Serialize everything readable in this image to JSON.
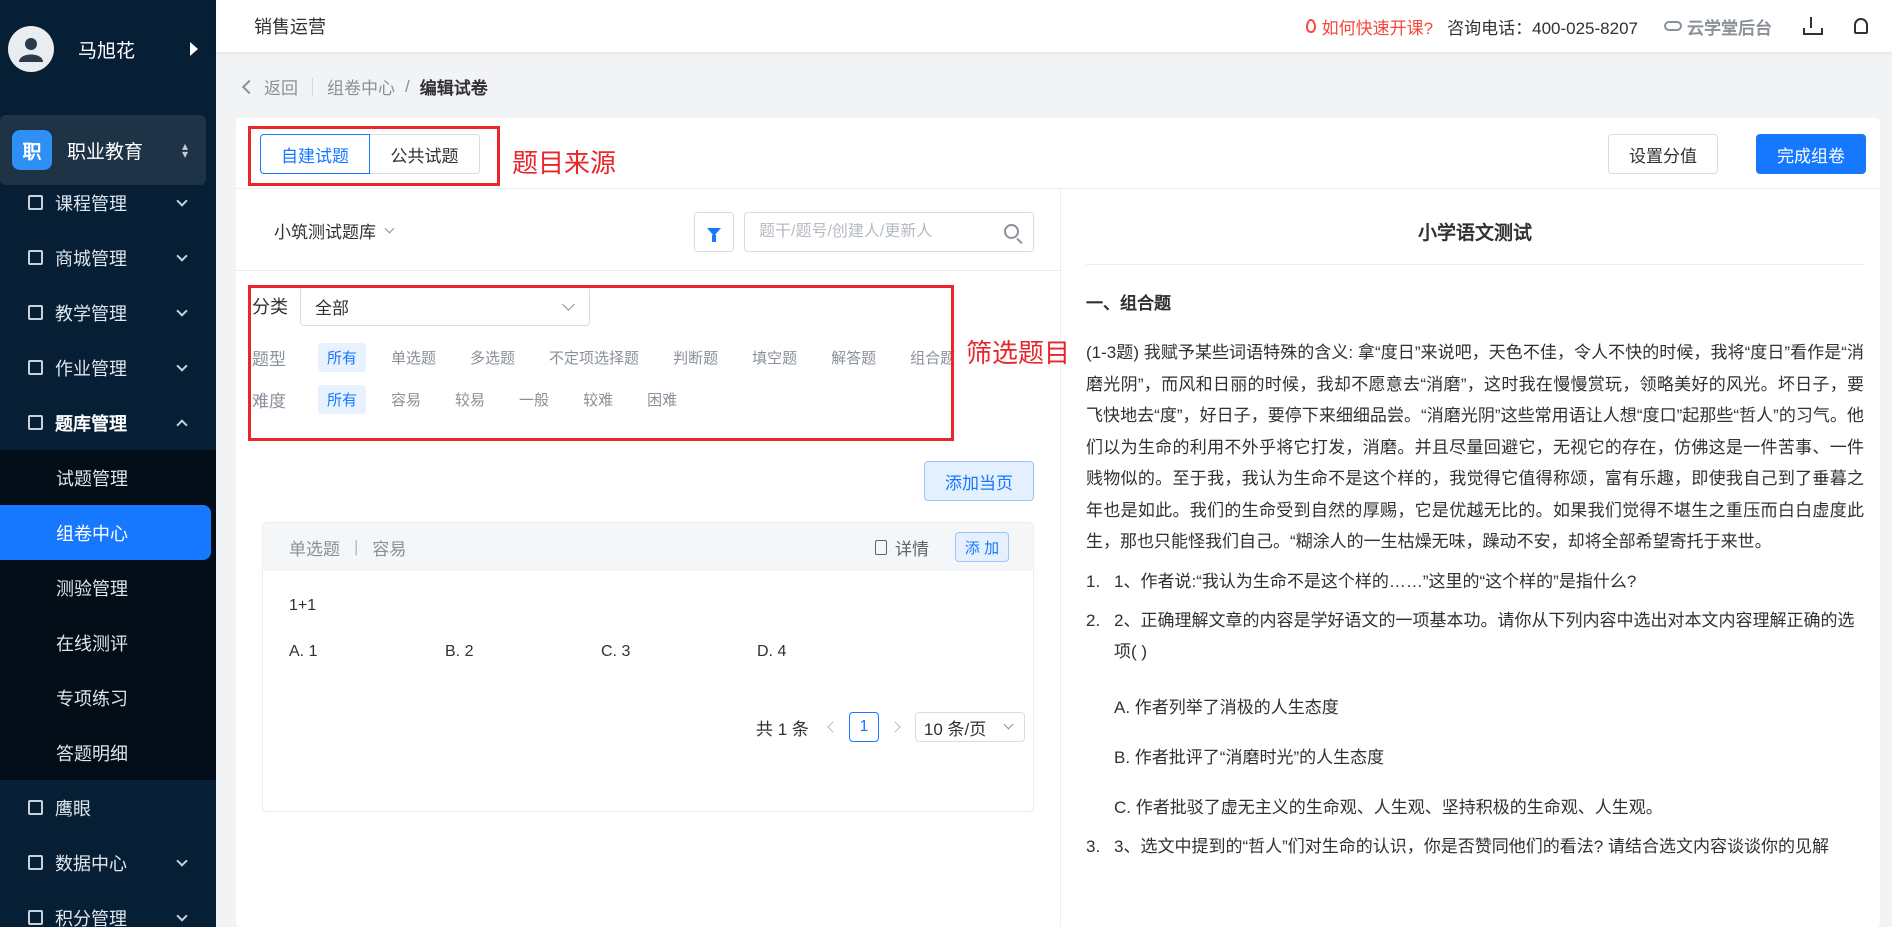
{
  "sidebar": {
    "user_name": "马旭花",
    "org_badge": "职",
    "org_name": "职业教育",
    "menu_top": [
      {
        "label": "课程管理"
      },
      {
        "label": "商城管理"
      },
      {
        "label": "教学管理"
      },
      {
        "label": "作业管理"
      },
      {
        "label": "题库管理"
      }
    ],
    "submenu": [
      {
        "label": "试题管理"
      },
      {
        "label": "组卷中心"
      },
      {
        "label": "测验管理"
      },
      {
        "label": "在线测评"
      },
      {
        "label": "专项练习"
      },
      {
        "label": "答题明细"
      }
    ],
    "menu_bottom": [
      {
        "label": "鹰眼"
      },
      {
        "label": "数据中心"
      },
      {
        "label": "积分管理"
      }
    ]
  },
  "topbar": {
    "title": "销售运营",
    "quick_start": "如何快速开课?",
    "phone": "咨询电话：400-025-8207",
    "backend": "云学堂后台"
  },
  "breadcrumb": {
    "back": "返回",
    "parent": "组卷中心",
    "sep": "/",
    "current": "编辑试卷"
  },
  "source_tabs": [
    "自建试题",
    "公共试题"
  ],
  "buttons": {
    "set_score": "设置分值",
    "finish": "完成组卷",
    "add_page": "添加当页"
  },
  "annotations": {
    "source": "题目来源",
    "filter": "筛选题目"
  },
  "bank_name": "小筑测试题库",
  "search": {
    "placeholder": "题干/题号/创建人/更新人"
  },
  "filters": {
    "category_label": "分类",
    "category_value": "全部",
    "type_label": "题型",
    "types": [
      "所有",
      "单选题",
      "多选题",
      "不定项选择题",
      "判断题",
      "填空题",
      "解答题",
      "组合题"
    ],
    "difficulty_label": "难度",
    "difficulties": [
      "所有",
      "容易",
      "较易",
      "一般",
      "较难",
      "困难"
    ]
  },
  "question": {
    "type": "单选题",
    "sep": "|",
    "difficulty": "容易",
    "detail": "详情",
    "add": "添 加",
    "stem": "1+1",
    "options": [
      "A.  1",
      "B.  2",
      "C.  3",
      "D.  4"
    ]
  },
  "pagination": {
    "total": "共 1 条",
    "current": "1",
    "page_size": "10 条/页"
  },
  "preview": {
    "title": "小学语文测试",
    "section": "一、组合题",
    "passage": "(1-3题)  我赋予某些词语特殊的含义: 拿“度日”来说吧，天色不佳，令人不快的时候，我将“度日”看作是“消磨光阴”，而风和日丽的时候，我却不愿意去“消磨”，这时我在慢慢赏玩，领略美好的风光。坏日子，要飞快地去“度”，好日子，要停下来细细品尝。“消磨光阴”这些常用语让人想“度口”起那些“哲人”的习气。他们以为生命的利用不外乎将它打发，消磨。并且尽量回避它，无视它的存在，仿佛这是一件苦事、一件贱物似的。至于我，我认为生命不是这个样的，我觉得它值得称颂，富有乐趣，即使我自己到了垂暮之年也是如此。我们的生命受到自然的厚赐，它是优越无比的。如果我们觉得不堪生之重压而白白虚度此生，那也只能怪我们自己。“糊涂人的一生枯燥无味，躁动不安，却将全部希望寄托于来世。",
    "questions": [
      {
        "num": "1.",
        "text": "1、作者说:“我认为生命不是这个样的……”这里的“这个样的”是指什么?"
      },
      {
        "num": "2.",
        "text": " 2、正确理解文章的内容是学好语文的一项基本功。请你从下列内容中选出对本文内容理解正确的选项( )"
      },
      {
        "num": "3.",
        "text": " 3、选文中提到的“哲人”们对生命的认识，你是否赞同他们的看法? 请结合选文内容谈谈你的见解"
      }
    ],
    "q2_options": [
      "A.  作者列举了消极的人生态度",
      "B.  作者批评了“消磨时光”的人生态度",
      "C.  作者批驳了虚无主义的生命观、人生观、坚持积极的生命观、人生观。"
    ]
  },
  "colors": {
    "primary": "#1677ff",
    "sidebar_bg": "#061f35",
    "annotation": "#e8262b",
    "warning": "#f5483b"
  }
}
